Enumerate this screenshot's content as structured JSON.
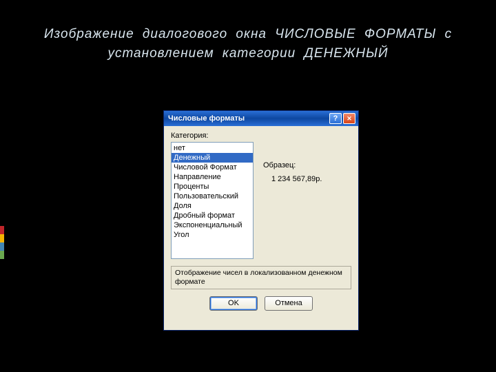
{
  "caption_line1": "Изображение диалогового окна ЧИСЛОВЫЕ ФОРМАТЫ с",
  "caption_line2": "установлением категории ДЕНЕЖНЫЙ",
  "dialog": {
    "title": "Числовые форматы",
    "category_label": "Категория:",
    "categories": [
      "нет",
      "Денежный",
      "Числовой Формат",
      "Направление",
      "Проценты",
      "Пользовательский",
      "Доля",
      "Дробный формат",
      "Экспоненциальный",
      "Угол"
    ],
    "selected_index": 1,
    "sample_label": "Образец:",
    "sample_value": "1 234 567,89р.",
    "description": "Отображение чисел в локализованном денежном формате",
    "ok": "OK",
    "cancel": "Отмена"
  }
}
